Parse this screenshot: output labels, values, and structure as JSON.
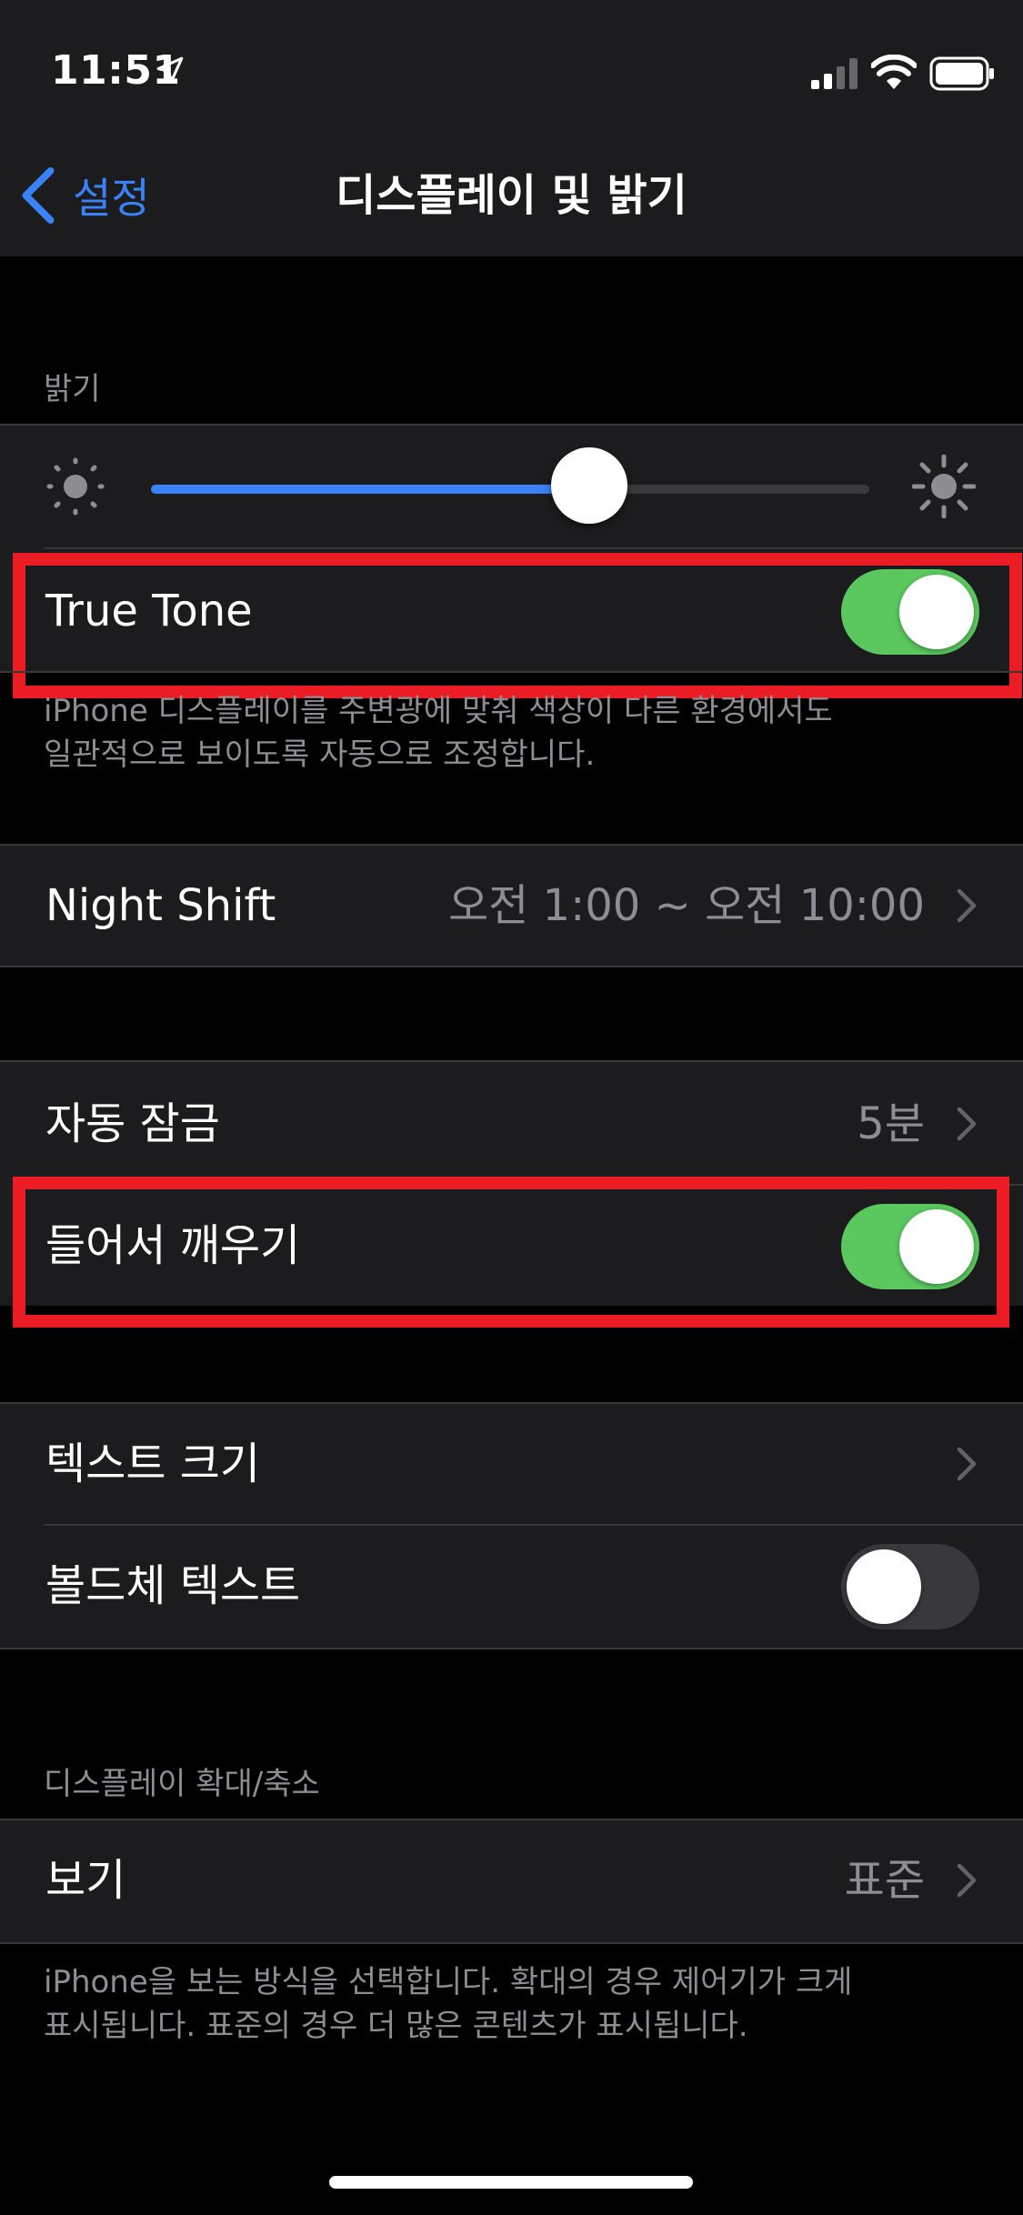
{
  "status_bar": {
    "time": "11:51",
    "icons": [
      "location-arrow-icon",
      "cellular-signal-icon",
      "wifi-icon",
      "battery-icon"
    ]
  },
  "nav": {
    "back_label": "설정",
    "title": "디스플레이 및 밝기"
  },
  "brightness": {
    "header": "밝기",
    "level": 0.61,
    "true_tone": {
      "label": "True Tone",
      "on": true,
      "description_line1": "iPhone 디스플레이를 주변광에 맞춰 색상이 다른 환경에서도",
      "description_line2": "일관적으로 보이도록 자동으로 조정합니다."
    }
  },
  "night_shift": {
    "label": "Night Shift",
    "value": "오전 1:00 ~ 오전 10:00"
  },
  "lock": {
    "auto_lock": {
      "label": "자동 잠금",
      "value": "5분"
    },
    "raise_to_wake": {
      "label": "들어서 깨우기",
      "on": true
    }
  },
  "text": {
    "text_size": {
      "label": "텍스트 크기"
    },
    "bold_text": {
      "label": "볼드체 텍스트",
      "on": false
    }
  },
  "display_zoom": {
    "header": "디스플레이 확대/축소",
    "view": {
      "label": "보기",
      "value": "표준"
    },
    "description_line1": "iPhone을 보는 방식을 선택합니다. 확대의 경우 제어기가 크게",
    "description_line2": "표시됩니다. 표준의 경우 더 많은 콘텐츠가 표시됩니다."
  },
  "colors": {
    "accent": "#3a82f7",
    "toggle_on": "#5ac85f",
    "highlight": "#ec1c24",
    "cell_bg": "#1c1c1e"
  }
}
